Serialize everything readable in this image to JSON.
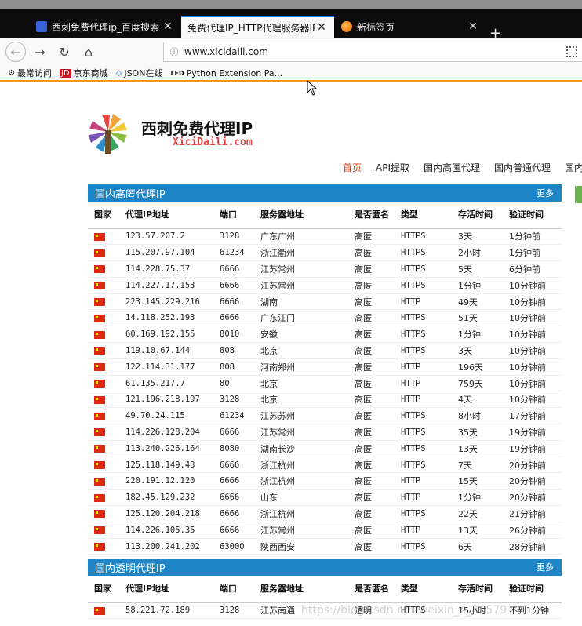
{
  "browser": {
    "tabs": [
      {
        "label": "西刺免费代理ip_百度搜索",
        "icon": "baidu-icon",
        "active": false
      },
      {
        "label": "免费代理IP_HTTP代理服务器IP_隐",
        "icon": "none",
        "active": true
      },
      {
        "label": "新标签页",
        "icon": "firefox-icon",
        "active": false
      }
    ],
    "url": "www.xicidaili.com",
    "bookmarks": [
      {
        "label": "最常访问",
        "icon": "gear-icon"
      },
      {
        "label": "京东商城",
        "icon": "jd-icon"
      },
      {
        "label": "JSON在线",
        "icon": "code-icon"
      },
      {
        "label": "Python Extension Pa...",
        "icon": "lfd-icon"
      }
    ]
  },
  "site": {
    "title": "西刺免费代理IP",
    "subtitle": "XiciDaili.com",
    "nav": [
      "首页",
      "API提取",
      "国内高匿代理",
      "国内普通代理",
      "国内"
    ]
  },
  "sections": [
    {
      "title": "国内高匿代理IP",
      "more": "更多",
      "headers": [
        "国家",
        "代理IP地址",
        "端口",
        "服务器地址",
        "是否匿名",
        "类型",
        "存活时间",
        "验证时间"
      ],
      "rows": [
        [
          "123.57.207.2",
          "3128",
          "广东广州",
          "高匿",
          "HTTPS",
          "3天",
          "1分钟前"
        ],
        [
          "115.207.97.104",
          "61234",
          "浙江衢州",
          "高匿",
          "HTTPS",
          "2小时",
          "1分钟前"
        ],
        [
          "114.228.75.37",
          "6666",
          "江苏常州",
          "高匿",
          "HTTPS",
          "5天",
          "6分钟前"
        ],
        [
          "114.227.17.153",
          "6666",
          "江苏常州",
          "高匿",
          "HTTPS",
          "1分钟",
          "10分钟前"
        ],
        [
          "223.145.229.216",
          "6666",
          "湖南",
          "高匿",
          "HTTP",
          "49天",
          "10分钟前"
        ],
        [
          "14.118.252.193",
          "6666",
          "广东江门",
          "高匿",
          "HTTPS",
          "51天",
          "10分钟前"
        ],
        [
          "60.169.192.155",
          "8010",
          "安徽",
          "高匿",
          "HTTPS",
          "1分钟",
          "10分钟前"
        ],
        [
          "119.10.67.144",
          "808",
          "北京",
          "高匿",
          "HTTPS",
          "3天",
          "10分钟前"
        ],
        [
          "122.114.31.177",
          "808",
          "河南郑州",
          "高匿",
          "HTTP",
          "196天",
          "10分钟前"
        ],
        [
          "61.135.217.7",
          "80",
          "北京",
          "高匿",
          "HTTP",
          "759天",
          "10分钟前"
        ],
        [
          "121.196.218.197",
          "3128",
          "北京",
          "高匿",
          "HTTP",
          "4天",
          "10分钟前"
        ],
        [
          "49.70.24.115",
          "61234",
          "江苏苏州",
          "高匿",
          "HTTPS",
          "8小时",
          "17分钟前"
        ],
        [
          "114.226.128.204",
          "6666",
          "江苏常州",
          "高匿",
          "HTTPS",
          "35天",
          "19分钟前"
        ],
        [
          "113.240.226.164",
          "8080",
          "湖南长沙",
          "高匿",
          "HTTPS",
          "13天",
          "19分钟前"
        ],
        [
          "125.118.149.43",
          "6666",
          "浙江杭州",
          "高匿",
          "HTTPS",
          "7天",
          "20分钟前"
        ],
        [
          "220.191.12.120",
          "6666",
          "浙江杭州",
          "高匿",
          "HTTP",
          "15天",
          "20分钟前"
        ],
        [
          "182.45.129.232",
          "6666",
          "山东",
          "高匿",
          "HTTP",
          "1分钟",
          "20分钟前"
        ],
        [
          "125.120.204.218",
          "6666",
          "浙江杭州",
          "高匿",
          "HTTPS",
          "22天",
          "21分钟前"
        ],
        [
          "114.226.105.35",
          "6666",
          "江苏常州",
          "高匿",
          "HTTP",
          "13天",
          "26分钟前"
        ],
        [
          "113.200.241.202",
          "63000",
          "陕西西安",
          "高匿",
          "HTTPS",
          "6天",
          "28分钟前"
        ]
      ]
    },
    {
      "title": "国内透明代理IP",
      "more": "更多",
      "headers": [
        "国家",
        "代理IP地址",
        "端口",
        "服务器地址",
        "是否匿名",
        "类型",
        "存活时间",
        "验证时间"
      ],
      "rows": [
        [
          "58.221.72.189",
          "3128",
          "江苏南通",
          "透明",
          "HTTPS",
          "15小时",
          "不到1分钟"
        ]
      ]
    }
  ],
  "watermark": "https://blog.csdn.net/weixin_4_40579"
}
